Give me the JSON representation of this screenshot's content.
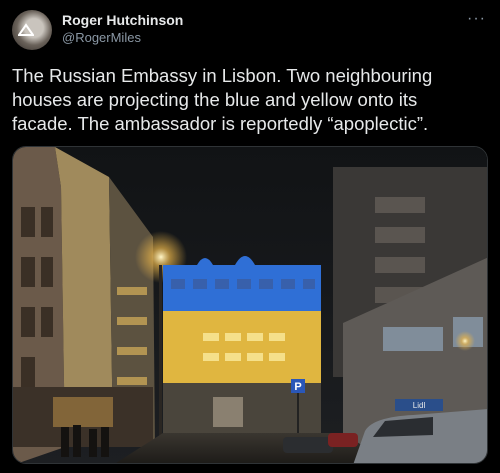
{
  "tweet": {
    "author_name": "Roger Hutchinson",
    "author_handle": "@RogerMiles",
    "more_label": "···",
    "text": "The Russian Embassy in Lisbon. Two neighbouring houses are projecting the blue and yellow onto its facade. The ambassador is reportedly “apoplectic”."
  },
  "media": {
    "parking_sign": "P",
    "shop_sign": "Lidl"
  },
  "colors": {
    "background": "#000000",
    "text": "#e7e9ea",
    "muted": "#8b98a5",
    "projection_blue": "#2f6fd6",
    "projection_yellow": "#e0b640"
  }
}
